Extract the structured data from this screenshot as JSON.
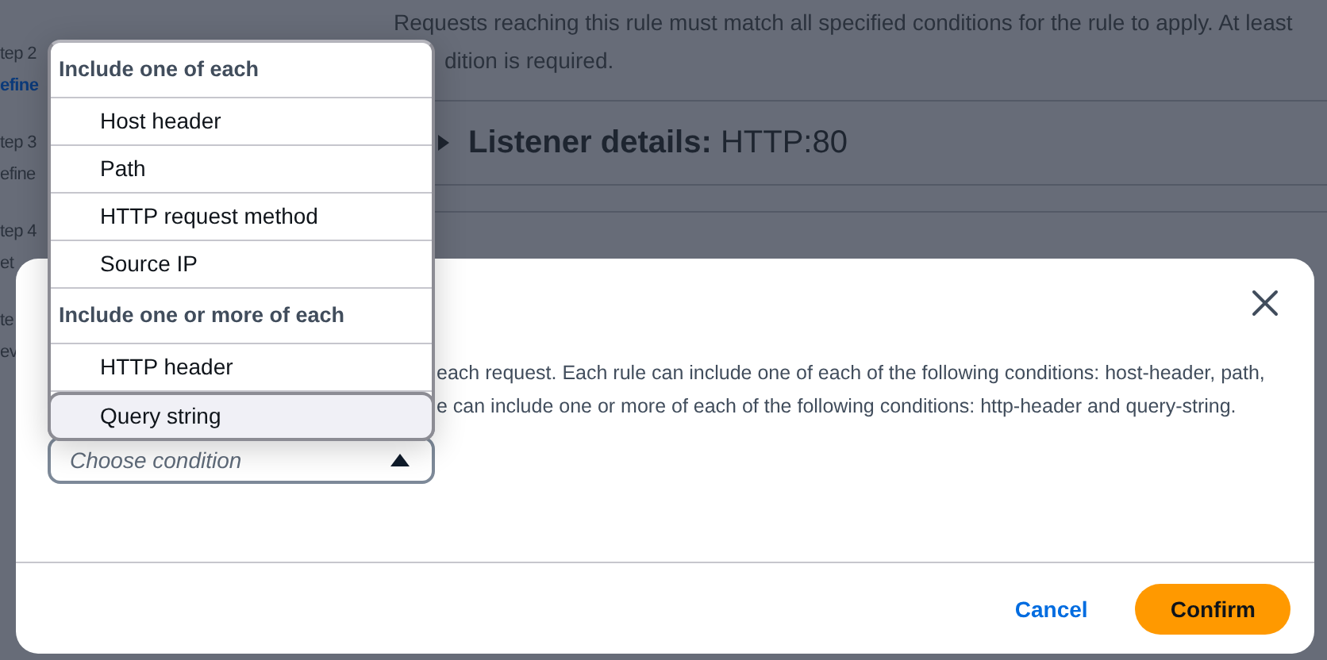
{
  "page": {
    "sidebar": [
      {
        "text": "tep 2",
        "kind": "step"
      },
      {
        "text": "efine",
        "kind": "link"
      },
      {
        "text": "tep 3",
        "kind": "step"
      },
      {
        "text": "efine",
        "kind": "current"
      },
      {
        "text": "tep 4",
        "kind": "step"
      },
      {
        "text": "et",
        "kind": "current"
      },
      {
        "text": "te",
        "kind": "step"
      },
      {
        "text": "ev",
        "kind": "current"
      }
    ],
    "description_lines": [
      "Requests reaching this rule must match all specified conditions for the rule to apply. At least",
      "dition is required."
    ],
    "listener": {
      "label": "Listener details:",
      "value": "HTTP:80"
    }
  },
  "modal": {
    "body_lines": [
      "each request. Each rule can include one of each of the following conditions: host-header, path,",
      "e can include one or more of each of the following conditions: http-header and query-string."
    ],
    "select": {
      "placeholder": "Choose condition",
      "expanded": true
    },
    "buttons": [
      {
        "label": "Cancel",
        "kind": "link"
      },
      {
        "label": "Confirm",
        "kind": "primary"
      }
    ]
  },
  "dropdown": {
    "groups": [
      {
        "label": "Include one of each",
        "options": [
          {
            "label": "Host header",
            "selected": false
          },
          {
            "label": "Path",
            "selected": false
          },
          {
            "label": "HTTP request method",
            "selected": false
          },
          {
            "label": "Source IP",
            "selected": false
          }
        ]
      },
      {
        "label": "Include one or more of each",
        "options": [
          {
            "label": "HTTP header",
            "selected": false
          },
          {
            "label": "Query string",
            "selected": true
          }
        ]
      }
    ]
  }
}
